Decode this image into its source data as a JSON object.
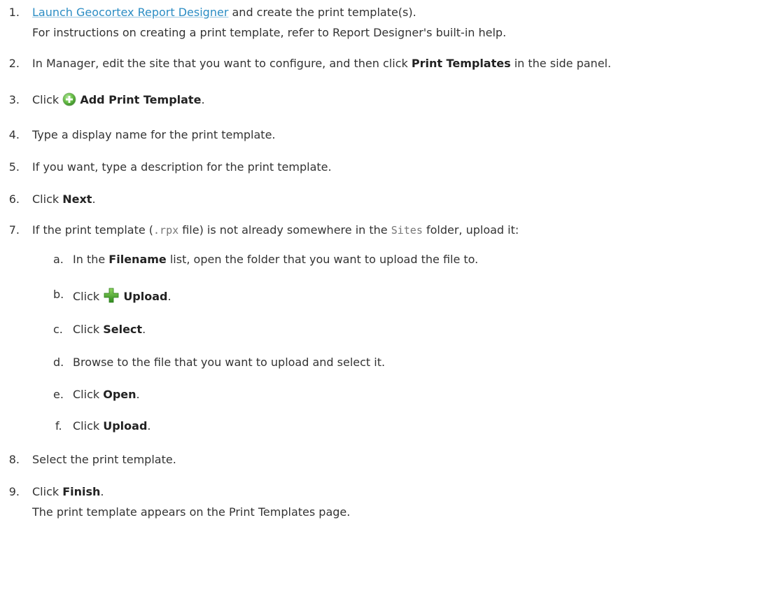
{
  "steps": {
    "s1": {
      "num": "1.",
      "link": "Launch Geocortex Report Designer",
      "rest": " and create the print template(s).",
      "sub": "For instructions on creating a print template, refer to Report Designer's built-in help."
    },
    "s2": {
      "num": "2.",
      "pre": "In Manager, edit the site that you want to configure, and then click ",
      "bold": "Print Templates",
      "post": " in the side panel."
    },
    "s3": {
      "num": "3.",
      "pre": "Click ",
      "icon": "add-circle-icon",
      "bold": "Add Print Template",
      "post": "."
    },
    "s4": {
      "num": "4.",
      "text": "Type a display name for the print template."
    },
    "s5": {
      "num": "5.",
      "text": "If you want, type a description for the print template."
    },
    "s6": {
      "num": "6.",
      "pre": "Click ",
      "bold": "Next",
      "post": "."
    },
    "s7": {
      "num": "7.",
      "pre": "If the print template (",
      "code1": ".rpx",
      "mid": " file) is not already somewhere in the ",
      "code2": "Sites",
      "post": " folder, upload it:",
      "substeps": {
        "a": {
          "letter": "a.",
          "pre": "In the ",
          "bold": "Filename",
          "post": " list, open the folder that you want to upload the file to."
        },
        "b": {
          "letter": "b.",
          "pre": "Click ",
          "icon": "green-plus-icon",
          "bold": "Upload",
          "post": "."
        },
        "c": {
          "letter": "c.",
          "pre": "Click ",
          "bold": "Select",
          "post": "."
        },
        "d": {
          "letter": "d.",
          "text": "Browse to the file that you want to upload and select it."
        },
        "e": {
          "letter": "e.",
          "pre": "Click ",
          "bold": "Open",
          "post": "."
        },
        "f": {
          "letter": "f.",
          "pre": "Click ",
          "bold": "Upload",
          "post": "."
        }
      }
    },
    "s8": {
      "num": "8.",
      "text": "Select the print template."
    },
    "s9": {
      "num": "9.",
      "pre": "Click ",
      "bold": "Finish",
      "post": ".",
      "sub": "The print template appears on the Print Templates page."
    }
  },
  "colors": {
    "text": "#333333",
    "link": "#2c8dc4",
    "code": "#777777",
    "add_icon_green": "#5cb85c",
    "plus_icon_green": "#3fa535"
  }
}
